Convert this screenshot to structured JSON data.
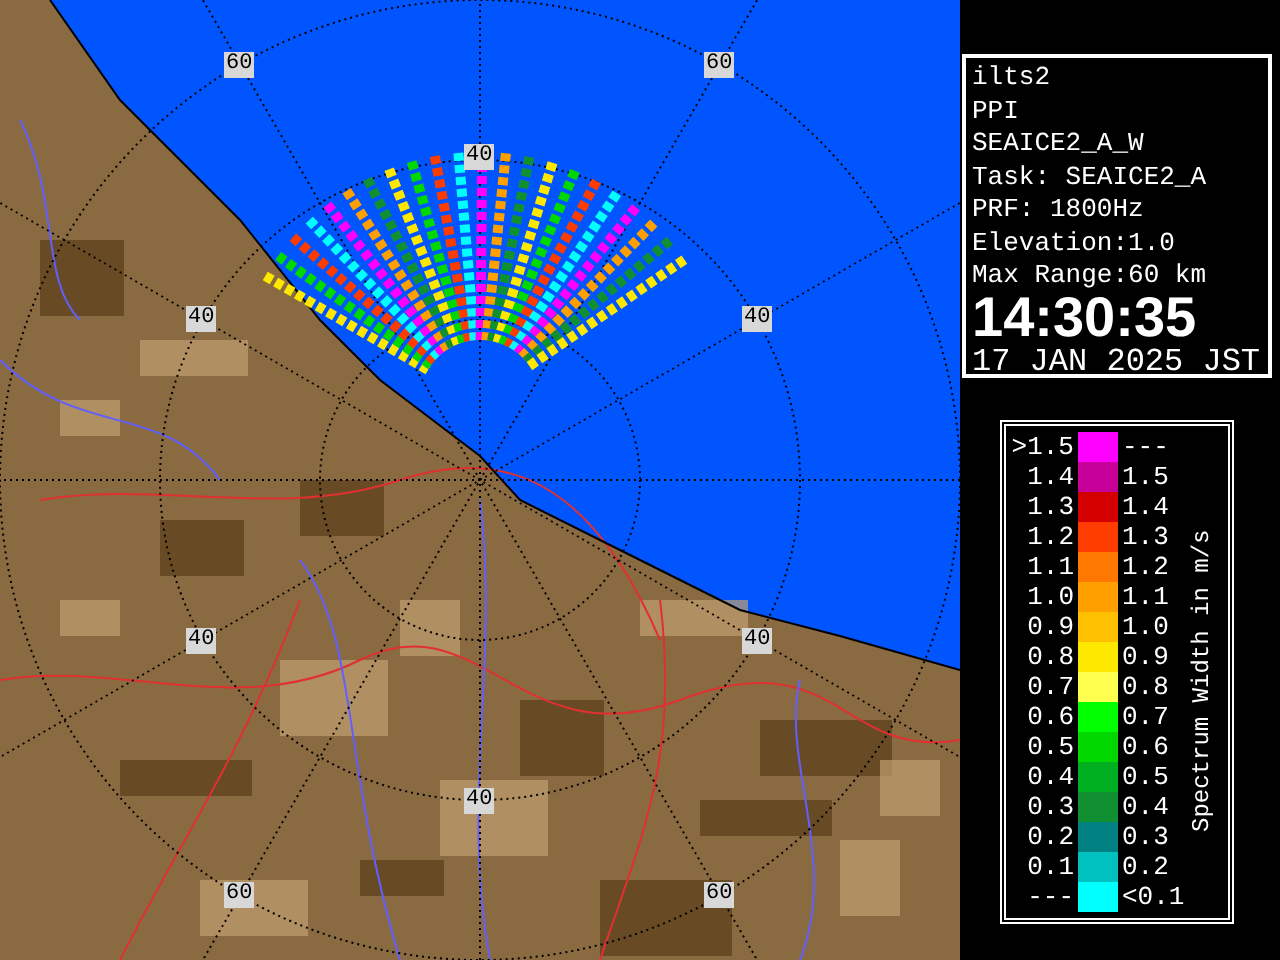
{
  "radar_map": {
    "range_labels": [
      "60",
      "60",
      "40",
      "40",
      "40",
      "40",
      "40",
      "40",
      "60",
      "60"
    ]
  },
  "info_panel": {
    "lines": [
      "ilts2",
      "PPI",
      "SEAICE2_A_W",
      "Task: SEAICE2_A",
      "PRF: 1800Hz",
      "Elevation:1.0",
      "Max Range:60 km"
    ],
    "time": "14:30:35",
    "date": "17 JAN 2025 JST"
  },
  "legend": {
    "title": "Spectrum Width in m/s",
    "rows": [
      {
        "left_label": ">1.5",
        "right_label": "---",
        "color": "#ff00ff"
      },
      {
        "left_label": "1.4",
        "right_label": "1.5",
        "color": "#c8009a"
      },
      {
        "left_label": "1.3",
        "right_label": "1.4",
        "color": "#d40000"
      },
      {
        "left_label": "1.2",
        "right_label": "1.3",
        "color": "#ff3c00"
      },
      {
        "left_label": "1.1",
        "right_label": "1.2",
        "color": "#ff7800"
      },
      {
        "left_label": "1.0",
        "right_label": "1.1",
        "color": "#ffa000"
      },
      {
        "left_label": "0.9",
        "right_label": "1.0",
        "color": "#ffc000"
      },
      {
        "left_label": "0.8",
        "right_label": "0.9",
        "color": "#ffe800"
      },
      {
        "left_label": "0.7",
        "right_label": "0.8",
        "color": "#ffff50"
      },
      {
        "left_label": "0.6",
        "right_label": "0.7",
        "color": "#00ff00"
      },
      {
        "left_label": "0.5",
        "right_label": "0.6",
        "color": "#00d800"
      },
      {
        "left_label": "0.4",
        "right_label": "0.5",
        "color": "#00b020"
      },
      {
        "left_label": "0.3",
        "right_label": "0.4",
        "color": "#109030"
      },
      {
        "left_label": "0.2",
        "right_label": "0.3",
        "color": "#008080"
      },
      {
        "left_label": "0.1",
        "right_label": "0.2",
        "color": "#00c0c0"
      },
      {
        "left_label": "---",
        "right_label": "<0.1",
        "color": "#00ffff"
      }
    ]
  }
}
